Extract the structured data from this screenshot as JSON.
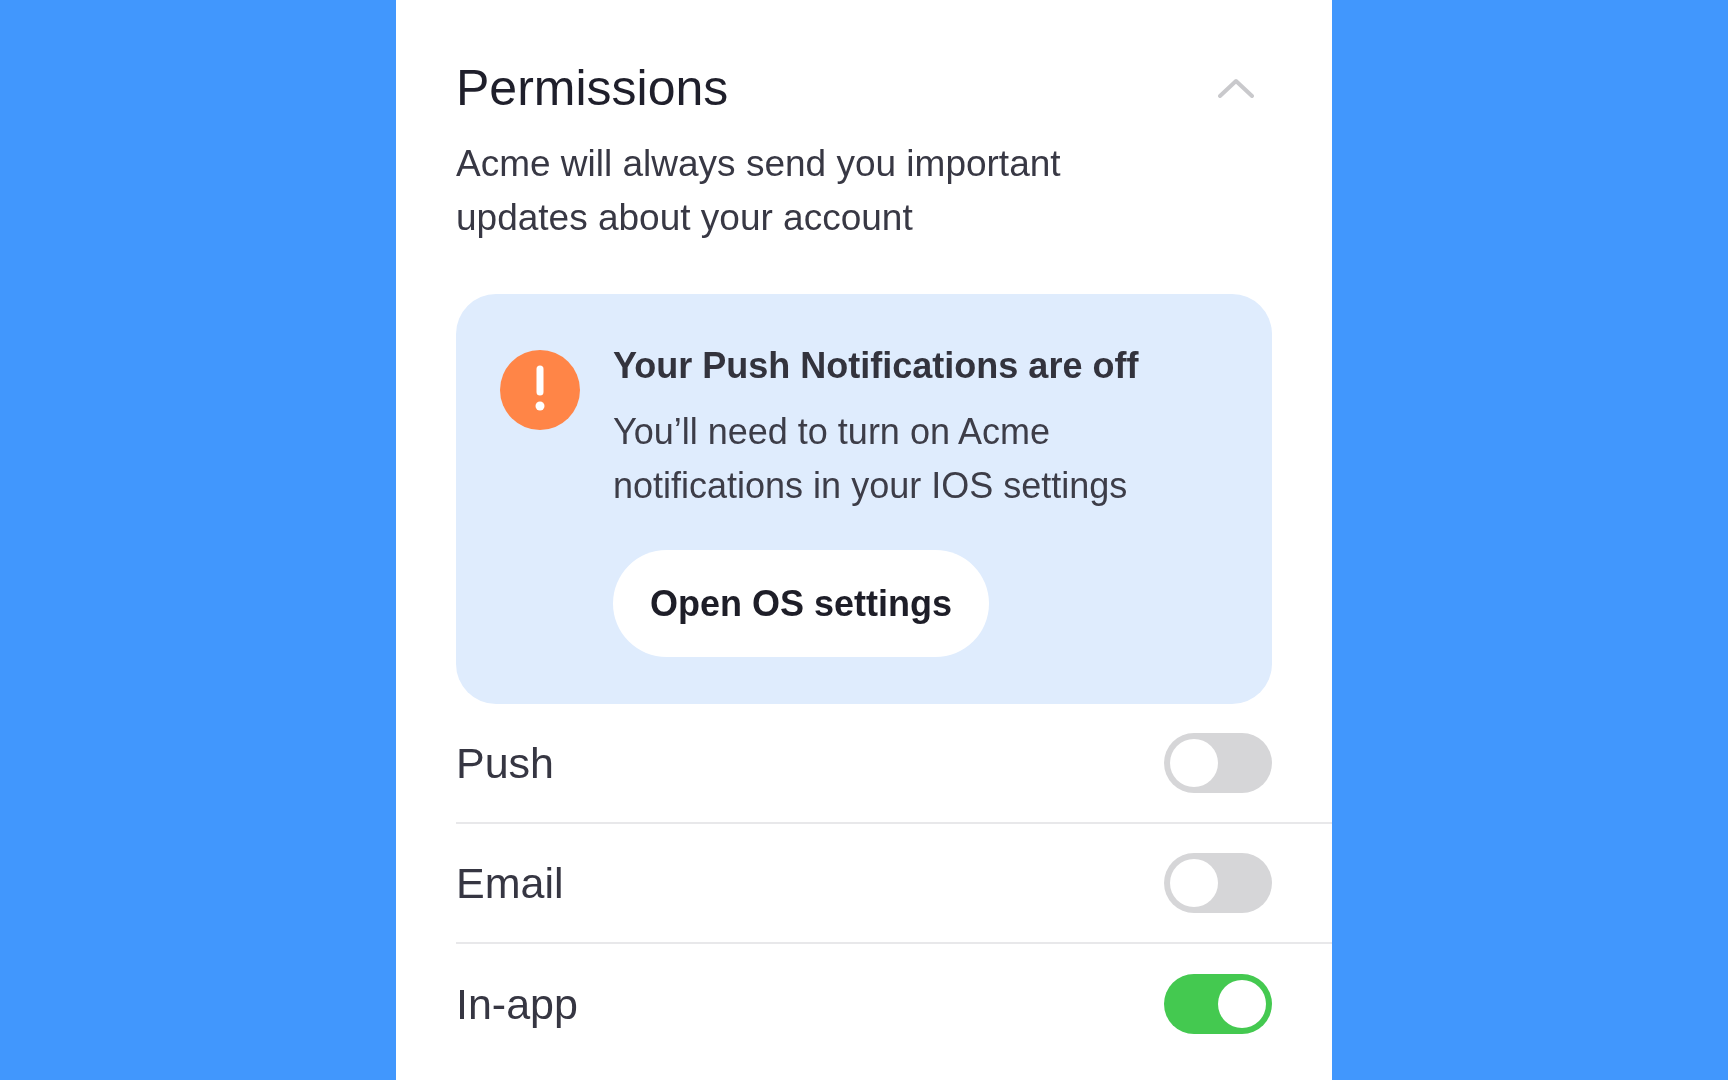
{
  "section": {
    "title": "Permissions",
    "expanded": true,
    "description": "Acme will always send you important updates about your account"
  },
  "alert": {
    "title": "Your Push Notifications are off",
    "message": "You’ll need to turn on Acme notifications in your IOS settings",
    "button": "Open OS settings"
  },
  "channels": [
    {
      "label": "Push",
      "on": false
    },
    {
      "label": "Email",
      "on": false
    },
    {
      "label": "In-app",
      "on": true
    }
  ]
}
